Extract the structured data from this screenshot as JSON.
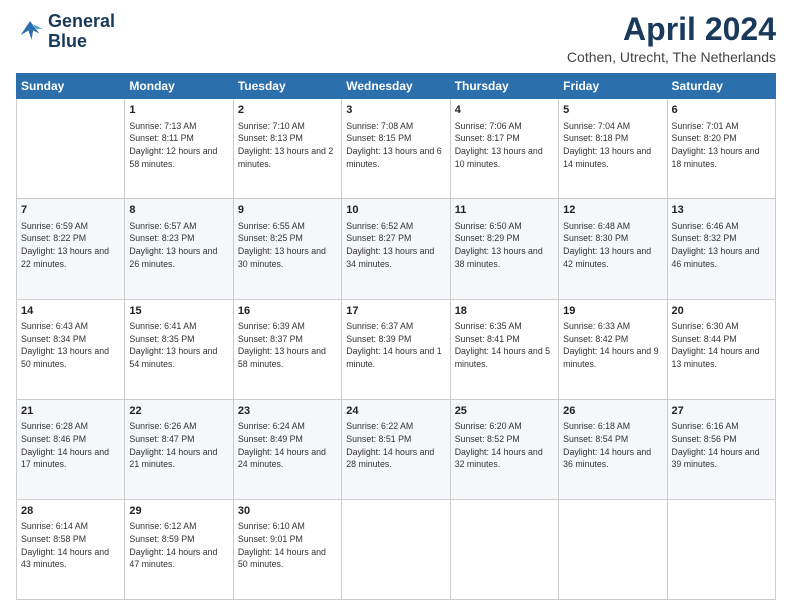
{
  "logo": {
    "line1": "General",
    "line2": "Blue"
  },
  "title": "April 2024",
  "subtitle": "Cothen, Utrecht, The Netherlands",
  "header_days": [
    "Sunday",
    "Monday",
    "Tuesday",
    "Wednesday",
    "Thursday",
    "Friday",
    "Saturday"
  ],
  "weeks": [
    [
      {
        "day": "",
        "sunrise": "",
        "sunset": "",
        "daylight": ""
      },
      {
        "day": "1",
        "sunrise": "Sunrise: 7:13 AM",
        "sunset": "Sunset: 8:11 PM",
        "daylight": "Daylight: 12 hours and 58 minutes."
      },
      {
        "day": "2",
        "sunrise": "Sunrise: 7:10 AM",
        "sunset": "Sunset: 8:13 PM",
        "daylight": "Daylight: 13 hours and 2 minutes."
      },
      {
        "day": "3",
        "sunrise": "Sunrise: 7:08 AM",
        "sunset": "Sunset: 8:15 PM",
        "daylight": "Daylight: 13 hours and 6 minutes."
      },
      {
        "day": "4",
        "sunrise": "Sunrise: 7:06 AM",
        "sunset": "Sunset: 8:17 PM",
        "daylight": "Daylight: 13 hours and 10 minutes."
      },
      {
        "day": "5",
        "sunrise": "Sunrise: 7:04 AM",
        "sunset": "Sunset: 8:18 PM",
        "daylight": "Daylight: 13 hours and 14 minutes."
      },
      {
        "day": "6",
        "sunrise": "Sunrise: 7:01 AM",
        "sunset": "Sunset: 8:20 PM",
        "daylight": "Daylight: 13 hours and 18 minutes."
      }
    ],
    [
      {
        "day": "7",
        "sunrise": "Sunrise: 6:59 AM",
        "sunset": "Sunset: 8:22 PM",
        "daylight": "Daylight: 13 hours and 22 minutes."
      },
      {
        "day": "8",
        "sunrise": "Sunrise: 6:57 AM",
        "sunset": "Sunset: 8:23 PM",
        "daylight": "Daylight: 13 hours and 26 minutes."
      },
      {
        "day": "9",
        "sunrise": "Sunrise: 6:55 AM",
        "sunset": "Sunset: 8:25 PM",
        "daylight": "Daylight: 13 hours and 30 minutes."
      },
      {
        "day": "10",
        "sunrise": "Sunrise: 6:52 AM",
        "sunset": "Sunset: 8:27 PM",
        "daylight": "Daylight: 13 hours and 34 minutes."
      },
      {
        "day": "11",
        "sunrise": "Sunrise: 6:50 AM",
        "sunset": "Sunset: 8:29 PM",
        "daylight": "Daylight: 13 hours and 38 minutes."
      },
      {
        "day": "12",
        "sunrise": "Sunrise: 6:48 AM",
        "sunset": "Sunset: 8:30 PM",
        "daylight": "Daylight: 13 hours and 42 minutes."
      },
      {
        "day": "13",
        "sunrise": "Sunrise: 6:46 AM",
        "sunset": "Sunset: 8:32 PM",
        "daylight": "Daylight: 13 hours and 46 minutes."
      }
    ],
    [
      {
        "day": "14",
        "sunrise": "Sunrise: 6:43 AM",
        "sunset": "Sunset: 8:34 PM",
        "daylight": "Daylight: 13 hours and 50 minutes."
      },
      {
        "day": "15",
        "sunrise": "Sunrise: 6:41 AM",
        "sunset": "Sunset: 8:35 PM",
        "daylight": "Daylight: 13 hours and 54 minutes."
      },
      {
        "day": "16",
        "sunrise": "Sunrise: 6:39 AM",
        "sunset": "Sunset: 8:37 PM",
        "daylight": "Daylight: 13 hours and 58 minutes."
      },
      {
        "day": "17",
        "sunrise": "Sunrise: 6:37 AM",
        "sunset": "Sunset: 8:39 PM",
        "daylight": "Daylight: 14 hours and 1 minute."
      },
      {
        "day": "18",
        "sunrise": "Sunrise: 6:35 AM",
        "sunset": "Sunset: 8:41 PM",
        "daylight": "Daylight: 14 hours and 5 minutes."
      },
      {
        "day": "19",
        "sunrise": "Sunrise: 6:33 AM",
        "sunset": "Sunset: 8:42 PM",
        "daylight": "Daylight: 14 hours and 9 minutes."
      },
      {
        "day": "20",
        "sunrise": "Sunrise: 6:30 AM",
        "sunset": "Sunset: 8:44 PM",
        "daylight": "Daylight: 14 hours and 13 minutes."
      }
    ],
    [
      {
        "day": "21",
        "sunrise": "Sunrise: 6:28 AM",
        "sunset": "Sunset: 8:46 PM",
        "daylight": "Daylight: 14 hours and 17 minutes."
      },
      {
        "day": "22",
        "sunrise": "Sunrise: 6:26 AM",
        "sunset": "Sunset: 8:47 PM",
        "daylight": "Daylight: 14 hours and 21 minutes."
      },
      {
        "day": "23",
        "sunrise": "Sunrise: 6:24 AM",
        "sunset": "Sunset: 8:49 PM",
        "daylight": "Daylight: 14 hours and 24 minutes."
      },
      {
        "day": "24",
        "sunrise": "Sunrise: 6:22 AM",
        "sunset": "Sunset: 8:51 PM",
        "daylight": "Daylight: 14 hours and 28 minutes."
      },
      {
        "day": "25",
        "sunrise": "Sunrise: 6:20 AM",
        "sunset": "Sunset: 8:52 PM",
        "daylight": "Daylight: 14 hours and 32 minutes."
      },
      {
        "day": "26",
        "sunrise": "Sunrise: 6:18 AM",
        "sunset": "Sunset: 8:54 PM",
        "daylight": "Daylight: 14 hours and 36 minutes."
      },
      {
        "day": "27",
        "sunrise": "Sunrise: 6:16 AM",
        "sunset": "Sunset: 8:56 PM",
        "daylight": "Daylight: 14 hours and 39 minutes."
      }
    ],
    [
      {
        "day": "28",
        "sunrise": "Sunrise: 6:14 AM",
        "sunset": "Sunset: 8:58 PM",
        "daylight": "Daylight: 14 hours and 43 minutes."
      },
      {
        "day": "29",
        "sunrise": "Sunrise: 6:12 AM",
        "sunset": "Sunset: 8:59 PM",
        "daylight": "Daylight: 14 hours and 47 minutes."
      },
      {
        "day": "30",
        "sunrise": "Sunrise: 6:10 AM",
        "sunset": "Sunset: 9:01 PM",
        "daylight": "Daylight: 14 hours and 50 minutes."
      },
      {
        "day": "",
        "sunrise": "",
        "sunset": "",
        "daylight": ""
      },
      {
        "day": "",
        "sunrise": "",
        "sunset": "",
        "daylight": ""
      },
      {
        "day": "",
        "sunrise": "",
        "sunset": "",
        "daylight": ""
      },
      {
        "day": "",
        "sunrise": "",
        "sunset": "",
        "daylight": ""
      }
    ]
  ]
}
